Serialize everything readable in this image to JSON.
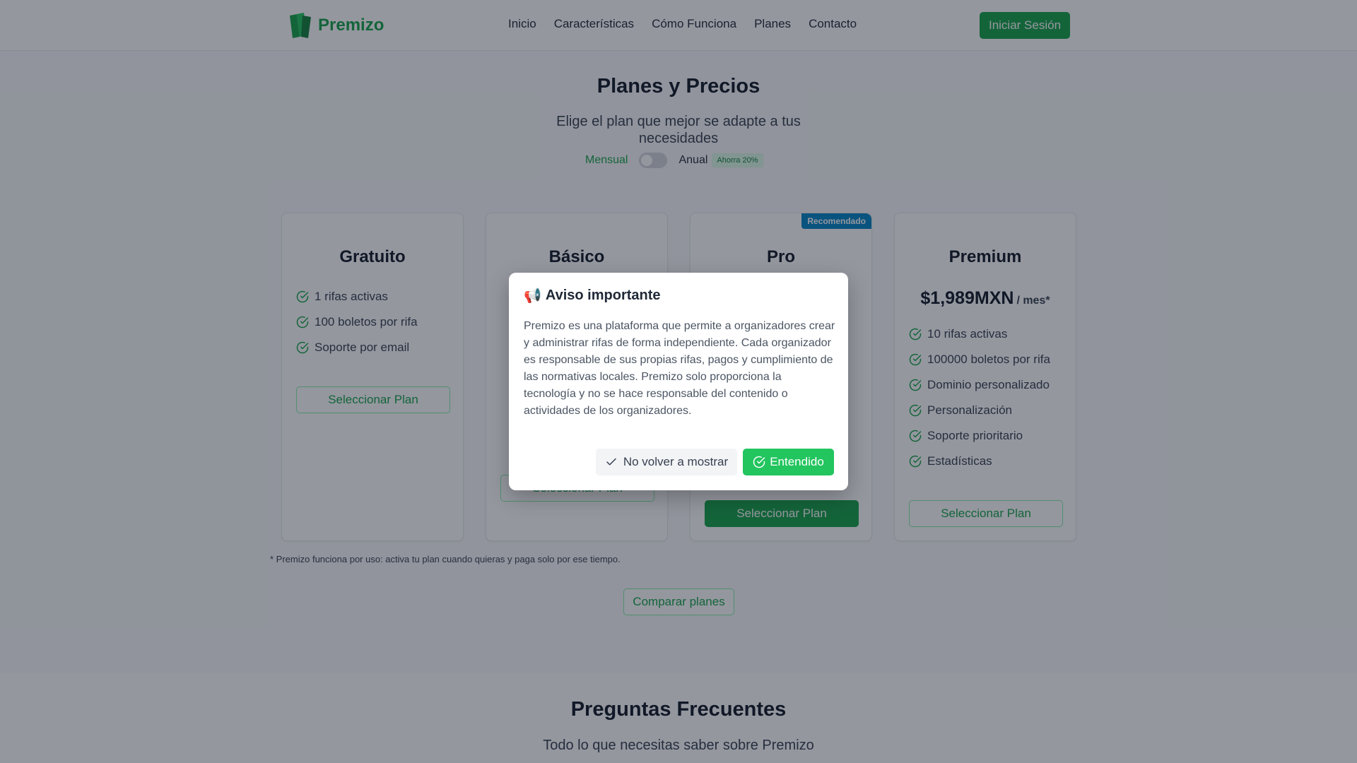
{
  "header": {
    "brand": "Premizo",
    "nav": [
      "Inicio",
      "Características",
      "Cómo Funciona",
      "Planes",
      "Contacto"
    ],
    "login_label": "Iniciar Sesión"
  },
  "pricing": {
    "title": "Planes y Precios",
    "subtitle": "Elige el plan que mejor se adapte a tus necesidades",
    "billing_monthly": "Mensual",
    "billing_annual": "Anual",
    "save_badge": "Ahorra 20%",
    "plans": [
      {
        "name": "Gratuito",
        "features": [
          "1 rifas activas",
          "100 boletos por rifa",
          "Soporte por email"
        ],
        "button": "Seleccionar Plan"
      },
      {
        "name": "Básico",
        "button": "Seleccionar Plan"
      },
      {
        "name": "Pro",
        "badge": "Recomendado",
        "button": "Seleccionar Plan"
      },
      {
        "name": "Premium",
        "price": "$1,989MXN",
        "period": "/ mes*",
        "features": [
          "10 rifas activas",
          "100000 boletos por rifa",
          "Dominio personalizado",
          "Personalización",
          "Soporte prioritario",
          "Estadísticas"
        ],
        "button": "Seleccionar Plan"
      }
    ],
    "footnote": "* Premizo funciona por uso: activa tu plan cuando quieras y paga solo por ese tiempo.",
    "compare_label": "Comparar planes"
  },
  "faq": {
    "title": "Preguntas Frecuentes",
    "subtitle": "Todo lo que necesitas saber sobre Premizo"
  },
  "modal": {
    "icon": "📢",
    "title": "Aviso importante",
    "body": "Premizo es una plataforma que permite a organizadores crear y administrar rifas de forma independiente. Cada organizador es responsable de sus propias rifas, pagos y cumplimiento de las normativas locales. Premizo solo proporciona la tecnología y no se hace responsable del contenido o actividades de los organizadores.",
    "dismiss_label": "No volver a mostrar",
    "ok_label": "Entendido"
  },
  "colors": {
    "brand_green": "#16a34a",
    "badge_blue": "#0284c7"
  }
}
